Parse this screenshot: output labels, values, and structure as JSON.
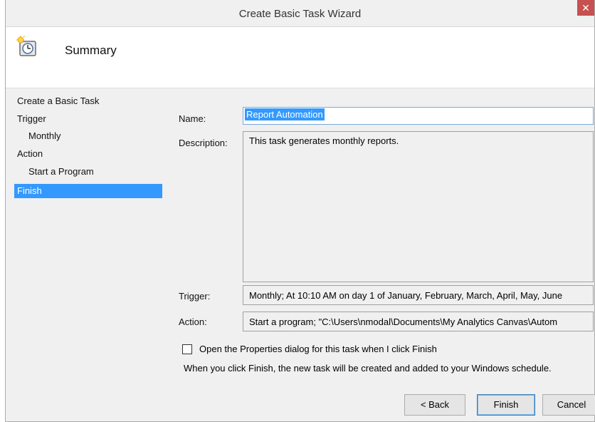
{
  "window": {
    "title": "Create Basic Task Wizard",
    "close_glyph": "✕"
  },
  "header": {
    "icon": "task-scheduler-clock-icon",
    "title": "Summary"
  },
  "nav": {
    "items": [
      {
        "label": "Create a Basic Task"
      },
      {
        "label": "Trigger"
      },
      {
        "label": "Monthly"
      },
      {
        "label": "Action"
      },
      {
        "label": "Start a Program"
      },
      {
        "label": "Finish"
      }
    ],
    "active": "Finish"
  },
  "form": {
    "name_label": "Name:",
    "name_value": "Report Automation",
    "description_label": "Description:",
    "description_value": "This task generates monthly reports.",
    "trigger_label": "Trigger:",
    "trigger_value": "Monthly; At 10:10 AM  on day 1 of January, February, March, April, May, June",
    "action_label": "Action:",
    "action_value": "Start a program; \"C:\\Users\\nmodal\\Documents\\My Analytics Canvas\\Autom"
  },
  "options": {
    "open_properties_label": "Open the Properties dialog for this task when I click Finish",
    "open_properties_checked": false,
    "info_text": "When you click Finish, the new task will be created and added to your Windows schedule."
  },
  "buttons": {
    "back": "< Back",
    "finish": "Finish",
    "cancel": "Cancel"
  },
  "colors": {
    "selection": "#3399ff",
    "close_button": "#c75050"
  }
}
